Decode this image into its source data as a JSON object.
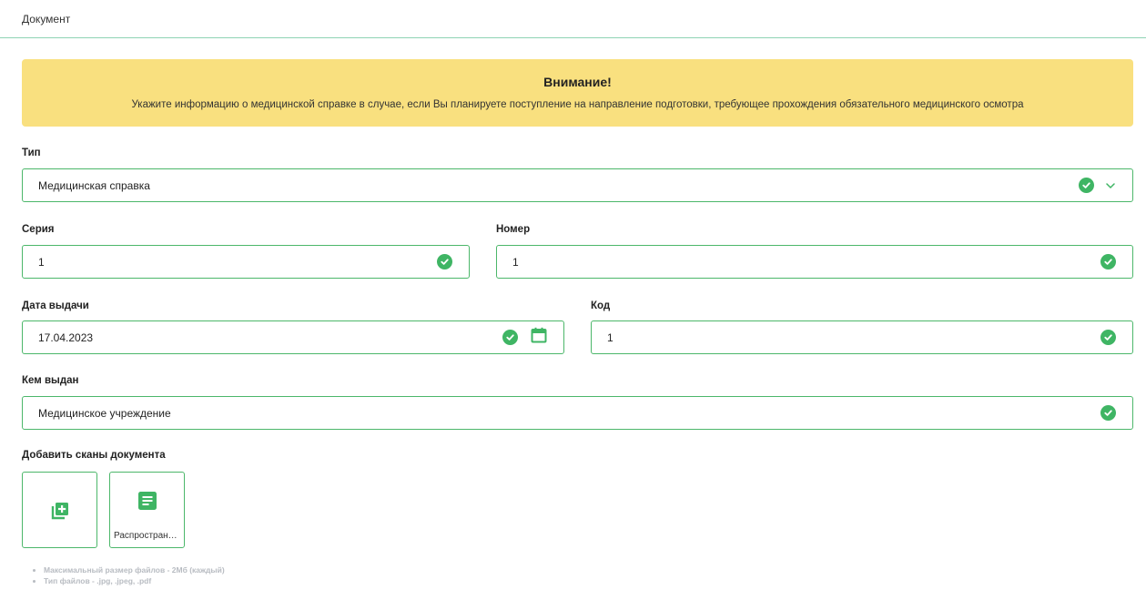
{
  "header": {
    "tab_label": "Документ"
  },
  "alert": {
    "title": "Внимание!",
    "text": "Укажите информацию о медицинской справке в случае, если Вы планируете поступление на направление подготовки, требующее прохождения обязательного медицинского осмотра"
  },
  "form": {
    "type": {
      "label": "Тип",
      "value": "Медицинская справка"
    },
    "series": {
      "label": "Серия",
      "value": "1"
    },
    "number": {
      "label": "Номер",
      "value": "1"
    },
    "issue_date": {
      "label": "Дата выдачи",
      "value": "17.04.2023"
    },
    "code": {
      "label": "Код",
      "value": "1"
    },
    "issued_by": {
      "label": "Кем выдан",
      "value": "Медицинское учреждение"
    }
  },
  "scans": {
    "label": "Добавить сканы документа",
    "files": [
      {
        "name": "Распространение"
      }
    ],
    "hints": [
      "Максимальный размер файлов - 2Мб (каждый)",
      "Тип файлов - .jpg, .jpeg, .pdf"
    ]
  },
  "colors": {
    "accent_green": "#3fb564",
    "border_green": "#4cb76a",
    "alert_bg": "#f9e07f",
    "hint_gray": "#b8bcc2"
  },
  "icons": {
    "valid": "check-circle-icon",
    "dropdown": "chevron-down-icon",
    "date": "calendar-icon",
    "add": "add-box-icon",
    "file": "document-icon"
  }
}
